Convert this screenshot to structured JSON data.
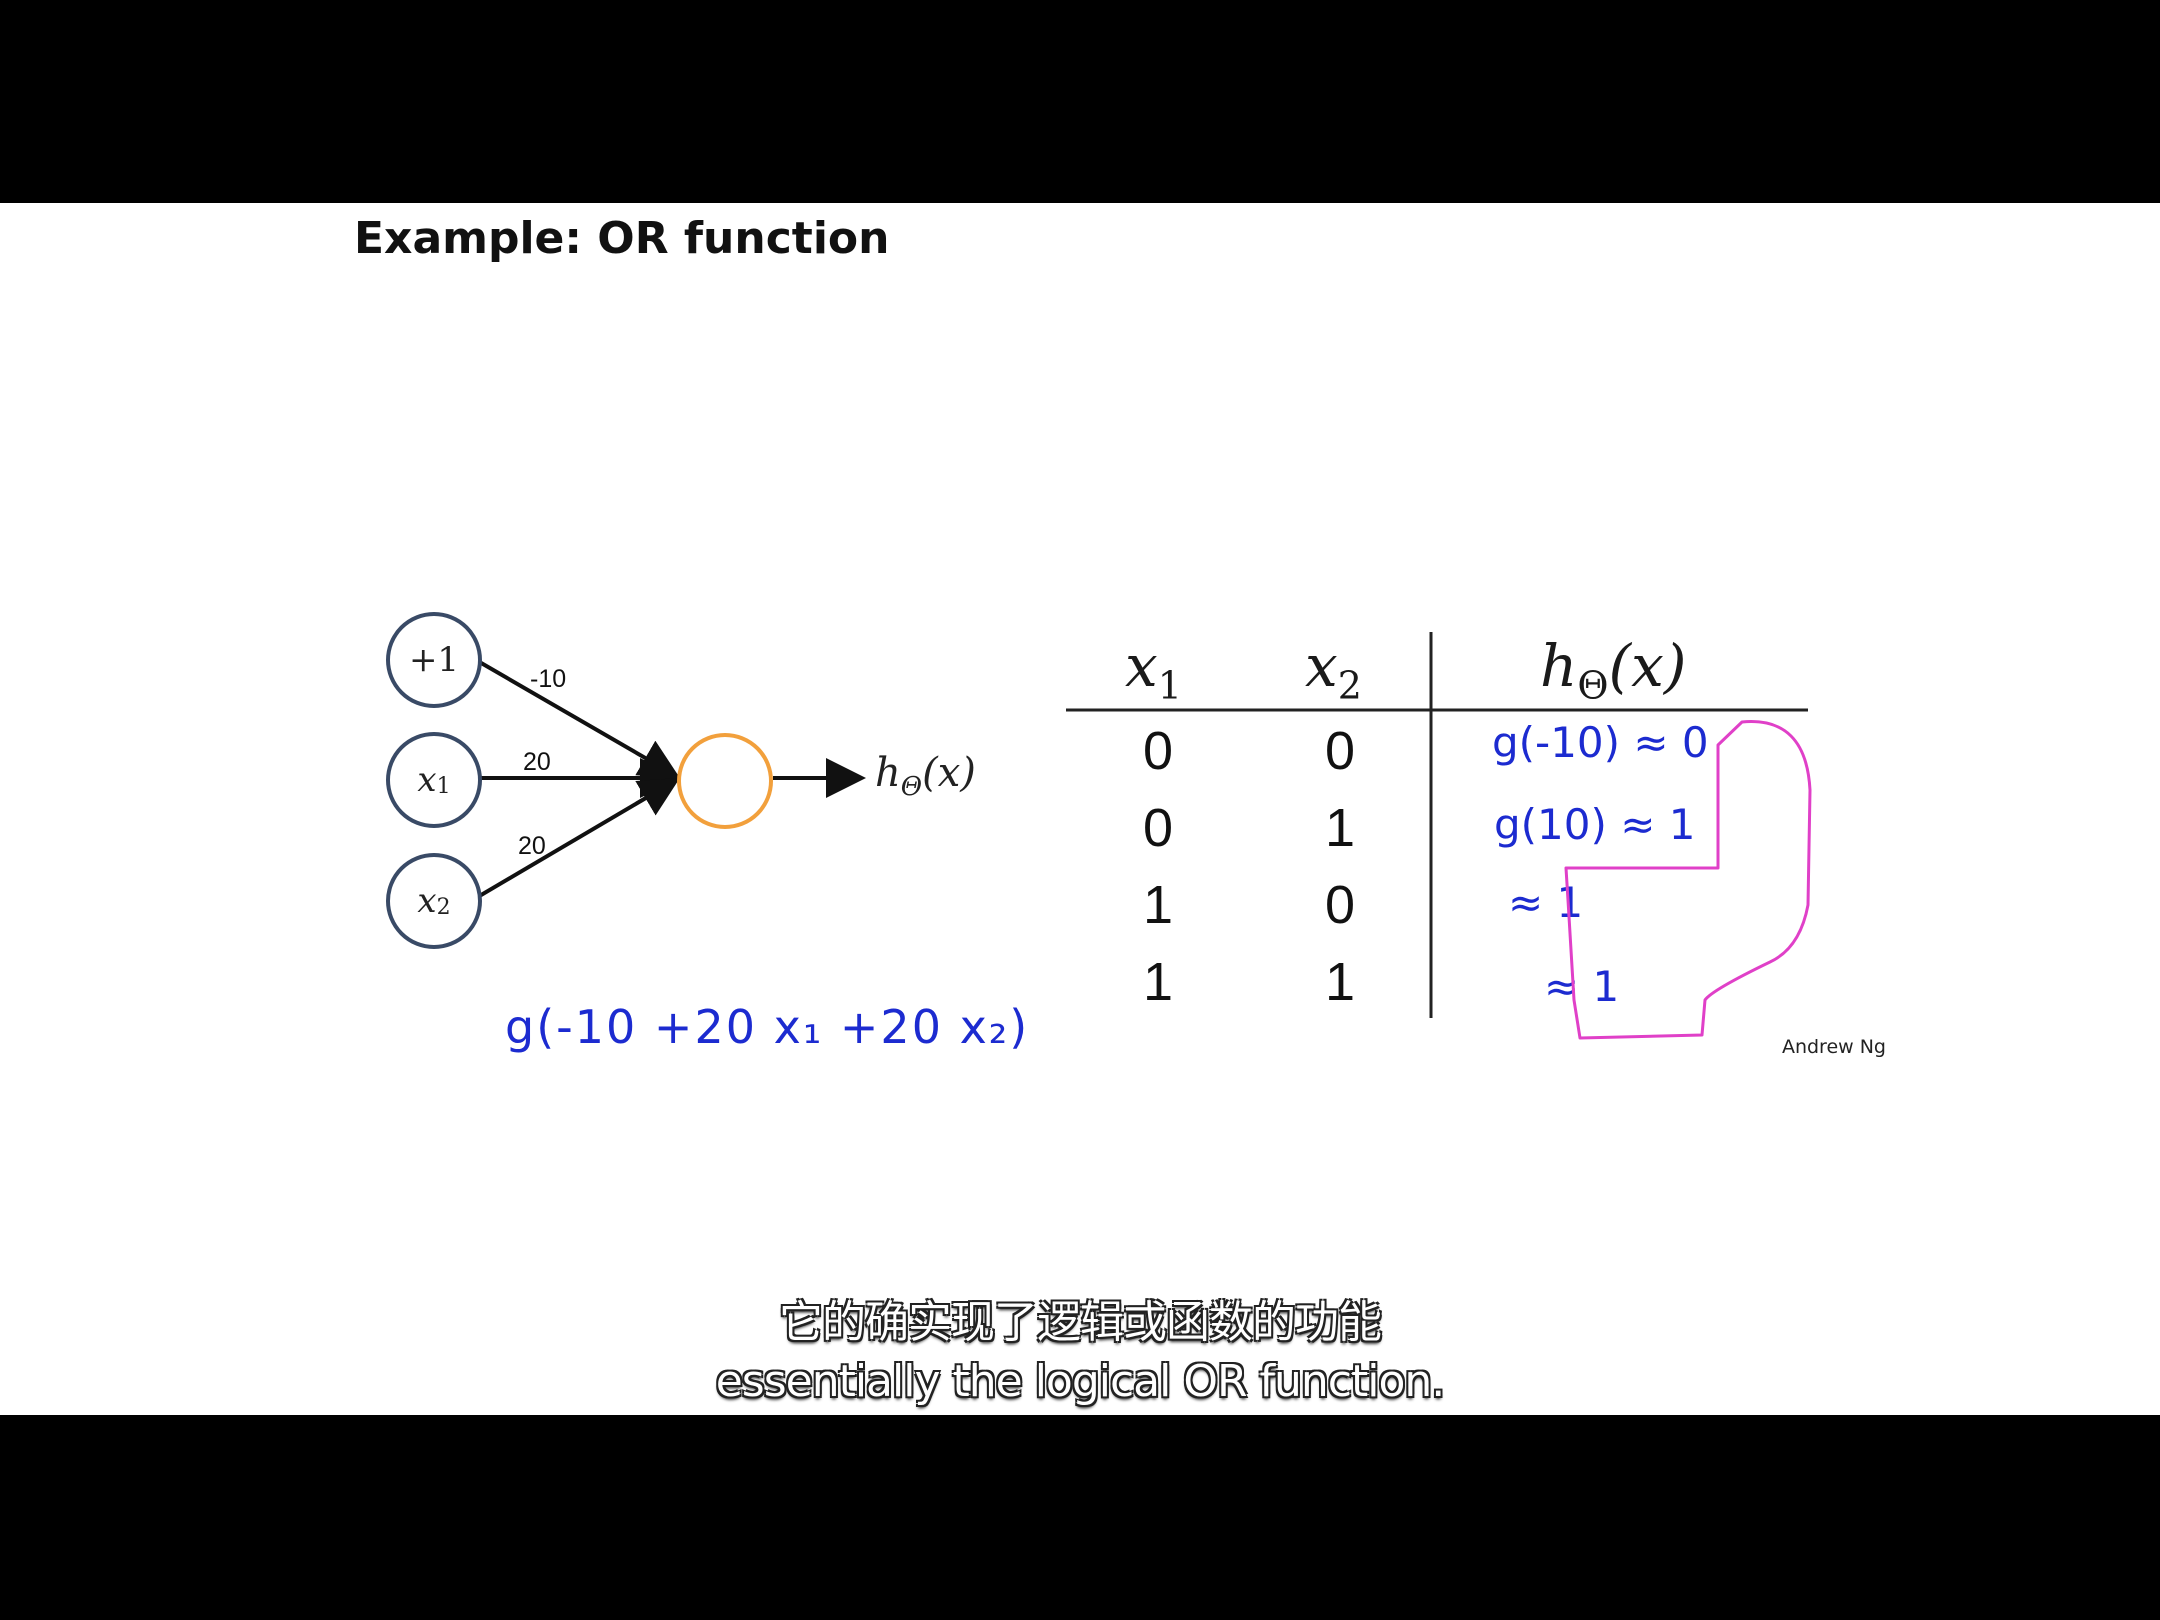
{
  "slide": {
    "title": "Example: OR function",
    "author": "Andrew Ng"
  },
  "network": {
    "nodes": {
      "bias": "+1",
      "x1": {
        "base": "x",
        "sub": "1"
      },
      "x2": {
        "base": "x",
        "sub": "2"
      }
    },
    "weights": {
      "bias": "-10",
      "x1": "20",
      "x2": "20"
    },
    "output_label": {
      "base": "h",
      "sub": "Θ",
      "arg": "(x)"
    }
  },
  "truth_table": {
    "headers": {
      "x1": {
        "base": "x",
        "sub": "1"
      },
      "x2": {
        "base": "x",
        "sub": "2"
      },
      "h": {
        "base": "h",
        "sub": "Θ",
        "arg": "(x)"
      }
    },
    "rows": [
      {
        "x1": "0",
        "x2": "0"
      },
      {
        "x1": "0",
        "x2": "1"
      },
      {
        "x1": "1",
        "x2": "0"
      },
      {
        "x1": "1",
        "x2": "1"
      }
    ]
  },
  "annotations": {
    "formula": "g(-10 +20 x₁ +20 x₂)",
    "rows": [
      "g(-10) ≈ 0",
      "g(10) ≈ 1",
      "≈ 1",
      "≈ 1"
    ],
    "ink_color": "#1c2bd0",
    "highlight_color": "#e040c8"
  },
  "subtitles": {
    "chinese": "它的确实现了逻辑或函数的功能",
    "english": "essentially the logical OR function."
  },
  "colors": {
    "node_border": "#394a66",
    "output_node_border": "#f2a03c"
  }
}
